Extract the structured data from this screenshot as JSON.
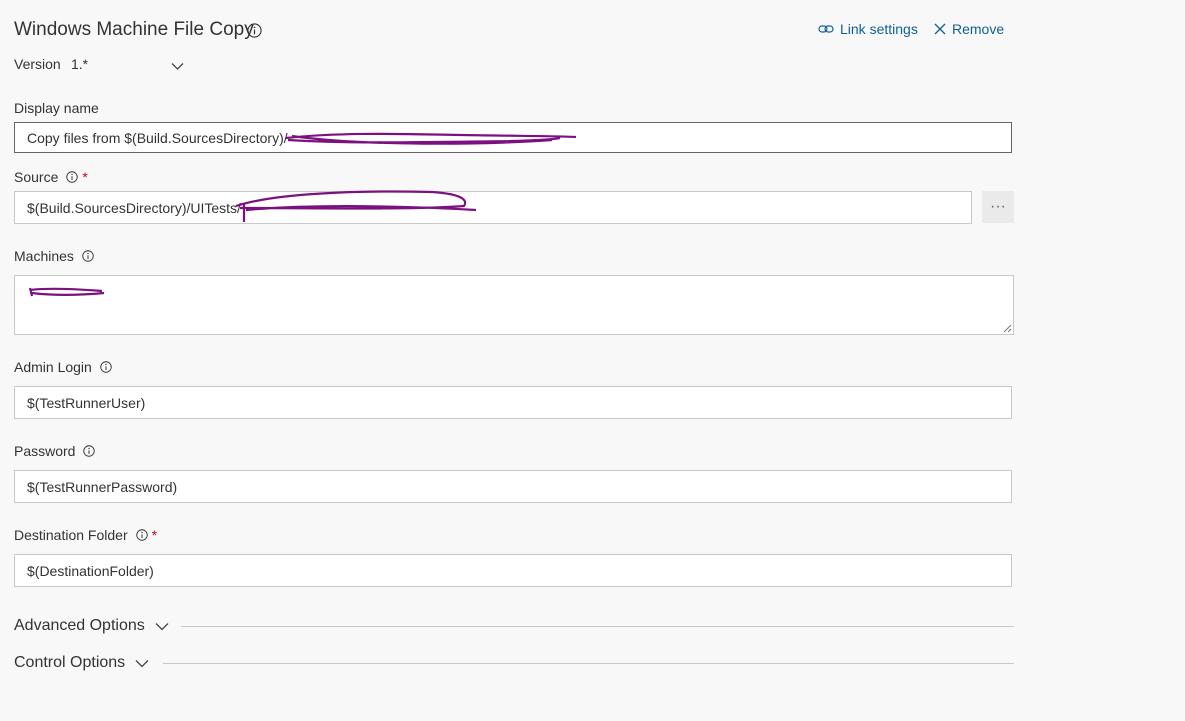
{
  "task": {
    "title": "Windows Machine File Copy",
    "link_settings_label": "Link settings",
    "remove_label": "Remove",
    "version_label": "Version",
    "version_value": "1.*"
  },
  "fields": {
    "display_name": {
      "label": "Display name",
      "value": "Copy files from $(Build.SourcesDirectory)/"
    },
    "source": {
      "label": "Source",
      "required_mark": "*",
      "value": "$(Build.SourcesDirectory)/UITests/",
      "browse_label": "···"
    },
    "machines": {
      "label": "Machines",
      "value": ""
    },
    "admin_login": {
      "label": "Admin Login",
      "value": "$(TestRunnerUser)"
    },
    "password": {
      "label": "Password",
      "value": "$(TestRunnerPassword)"
    },
    "destination_folder": {
      "label": "Destination Folder",
      "required_mark": "*",
      "value": "$(DestinationFolder)"
    }
  },
  "sections": {
    "advanced": "Advanced Options",
    "control": "Control Options"
  },
  "colors": {
    "background": "#f8f8f8",
    "link": "#0e6198",
    "required": "#d0021b",
    "redaction": "#7b1180"
  },
  "icons": {
    "info": "info-circle-icon",
    "link": "link-icon",
    "close": "close-x-icon",
    "chevron": "chevron-down-icon",
    "more": "more-horizontal-icon",
    "resize": "resize-grip-icon"
  }
}
